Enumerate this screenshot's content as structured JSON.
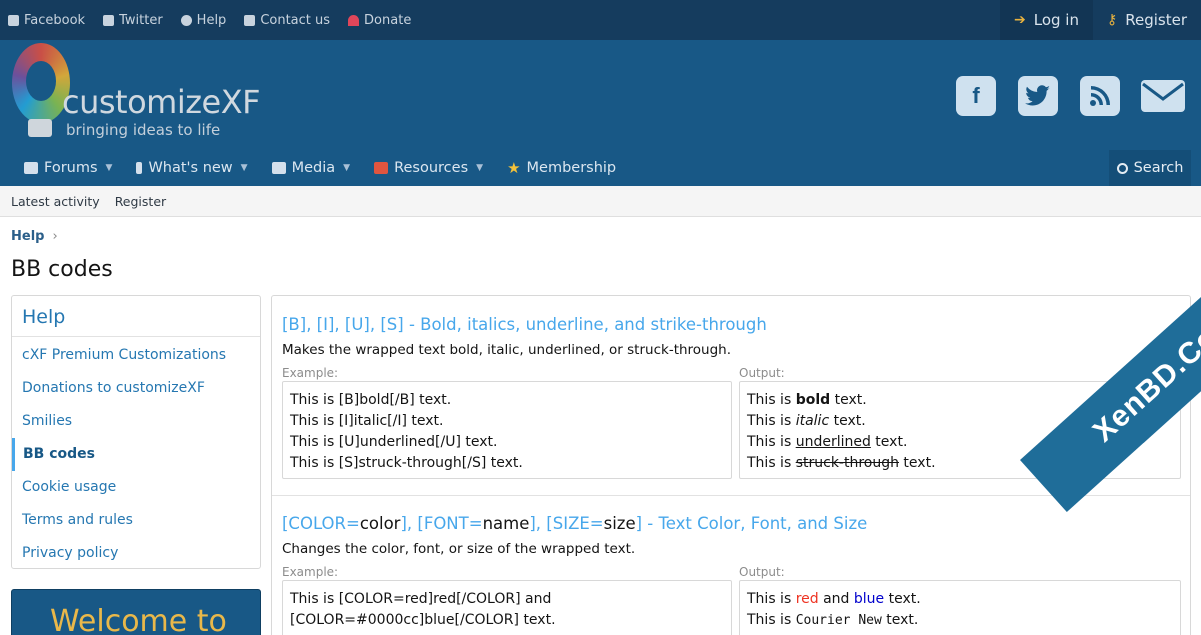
{
  "topbar": {
    "links": [
      {
        "label": "Facebook",
        "icon": "facebook-icon"
      },
      {
        "label": "Twitter",
        "icon": "twitter-icon"
      },
      {
        "label": "Help",
        "icon": "info-icon"
      },
      {
        "label": "Contact us",
        "icon": "envelope-icon"
      },
      {
        "label": "Donate",
        "icon": "heart-icon"
      }
    ],
    "login": "Log in",
    "register": "Register"
  },
  "logo": {
    "name": "customizeXF",
    "tagline": "bringing ideas to life"
  },
  "social": [
    "f",
    "t",
    "rss",
    "mail"
  ],
  "nav": {
    "items": [
      {
        "label": "Forums",
        "icon": "comments-icon",
        "dropdown": true
      },
      {
        "label": "What's new",
        "icon": "bolt-icon",
        "dropdown": true
      },
      {
        "label": "Media",
        "icon": "image-icon",
        "dropdown": true
      },
      {
        "label": "Resources",
        "icon": "download-icon",
        "dropdown": true
      },
      {
        "label": "Membership",
        "icon": "star-icon",
        "dropdown": false
      }
    ],
    "search": "Search"
  },
  "subnav": [
    "Latest activity",
    "Register"
  ],
  "breadcrumb": "Help",
  "page_title": "BB codes",
  "sidebar": {
    "heading": "Help",
    "items": [
      {
        "label": "cXF Premium Customizations",
        "active": false
      },
      {
        "label": "Donations to customizeXF",
        "active": false
      },
      {
        "label": "Smilies",
        "active": false
      },
      {
        "label": "BB codes",
        "active": true
      },
      {
        "label": "Cookie usage",
        "active": false
      },
      {
        "label": "Terms and rules",
        "active": false
      },
      {
        "label": "Privacy policy",
        "active": false
      }
    ]
  },
  "welcome": "Welcome to",
  "entries": [
    {
      "title": "[B], [I], [U], [S] - Bold, italics, underline, and strike-through",
      "desc": "Makes the wrapped text bold, italic, underlined, or struck-through.",
      "example_label": "Example:",
      "output_label": "Output:",
      "example": [
        "This is [B]bold[/B] text.",
        "This is [I]italic[/I] text.",
        "This is [U]underlined[/U] text.",
        "This is [S]struck-through[/S] text."
      ],
      "output": [
        {
          "pre": "This is ",
          "styled": "bold",
          "post": " text."
        },
        {
          "pre": "This is ",
          "styled": "italic",
          "post": " text."
        },
        {
          "pre": "This is ",
          "styled": "underlined",
          "post": " text."
        },
        {
          "pre": "This is ",
          "styled": "struck-through",
          "post": " text."
        }
      ]
    },
    {
      "title_parts": [
        "[COLOR=",
        "color",
        "], [FONT=",
        "name",
        "], [SIZE=",
        "size",
        "] - Text Color, Font, and Size"
      ],
      "desc": "Changes the color, font, or size of the wrapped text.",
      "example_label": "Example:",
      "output_label": "Output:",
      "example": [
        "This is [COLOR=red]red[/COLOR] and",
        "[COLOR=#0000cc]blue[/COLOR] text."
      ],
      "output_line1": {
        "pre": "This is ",
        "red": "red",
        "mid": " and ",
        "blue": "blue",
        "post": " text."
      },
      "output_line2": {
        "pre": "This is ",
        "mono": "Courier New",
        "post": " text."
      }
    }
  ],
  "watermark": "XenBD.Com",
  "colors": {
    "topbar": "#153c5e",
    "header": "#185886",
    "link": "#2577b1",
    "title": "#47a7eb"
  }
}
